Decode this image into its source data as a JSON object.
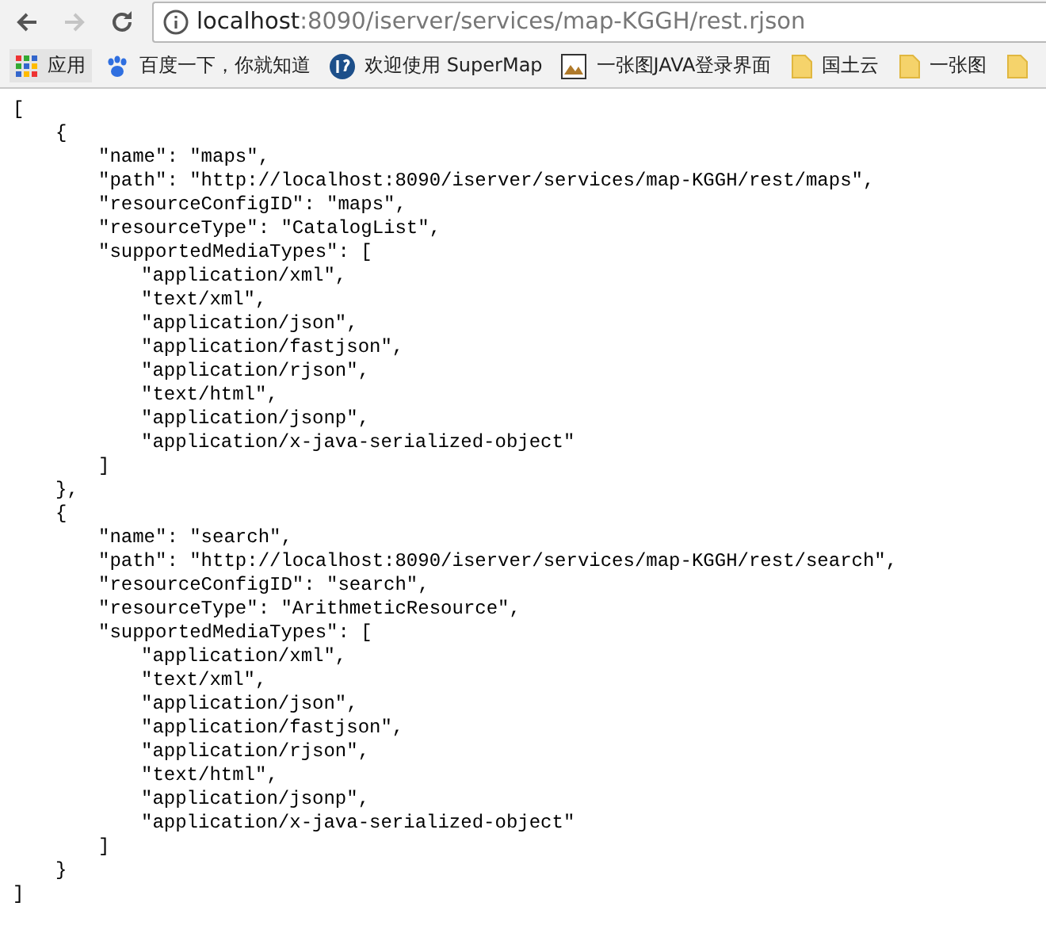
{
  "address_bar": {
    "host": "localhost",
    "path": ":8090/iserver/services/map-KGGH/rest.rjson"
  },
  "nav": {
    "back_disabled": false,
    "forward_disabled": true
  },
  "bookmarks": [
    {
      "kind": "apps",
      "label": "应用"
    },
    {
      "kind": "paw",
      "label": "百度一下，你就知道"
    },
    {
      "kind": "logo",
      "label": "欢迎使用 SuperMap"
    },
    {
      "kind": "image",
      "label": "一张图JAVA登录界面"
    },
    {
      "kind": "folder",
      "label": "国土云"
    },
    {
      "kind": "folder",
      "label": "一张图"
    },
    {
      "kind": "folder"
    }
  ],
  "document": {
    "open": "[",
    "close": "]",
    "children": [
      {
        "open": "{",
        "close": "},",
        "children": [
          {
            "text": "\"name\": \"maps\","
          },
          {
            "text": "\"path\": \"http://localhost:8090/iserver/services/map-KGGH/rest/maps\","
          },
          {
            "text": "\"resourceConfigID\": \"maps\","
          },
          {
            "text": "\"resourceType\": \"CatalogList\","
          },
          {
            "open": "\"supportedMediaTypes\": [",
            "close": "]",
            "children": [
              {
                "text": "\"application/xml\","
              },
              {
                "text": "\"text/xml\","
              },
              {
                "text": "\"application/json\","
              },
              {
                "text": "\"application/fastjson\","
              },
              {
                "text": "\"application/rjson\","
              },
              {
                "text": "\"text/html\","
              },
              {
                "text": "\"application/jsonp\","
              },
              {
                "text": "\"application/x-java-serialized-object\""
              }
            ]
          }
        ]
      },
      {
        "open": "{",
        "close": "}",
        "children": [
          {
            "text": "\"name\": \"search\","
          },
          {
            "text": "\"path\": \"http://localhost:8090/iserver/services/map-KGGH/rest/search\","
          },
          {
            "text": "\"resourceConfigID\": \"search\","
          },
          {
            "text": "\"resourceType\": \"ArithmeticResource\","
          },
          {
            "open": "\"supportedMediaTypes\": [",
            "close": "]",
            "children": [
              {
                "text": "\"application/xml\","
              },
              {
                "text": "\"text/xml\","
              },
              {
                "text": "\"application/json\","
              },
              {
                "text": "\"application/fastjson\","
              },
              {
                "text": "\"application/rjson\","
              },
              {
                "text": "\"text/html\","
              },
              {
                "text": "\"application/jsonp\","
              },
              {
                "text": "\"application/x-java-serialized-object\""
              }
            ]
          }
        ]
      }
    ]
  }
}
